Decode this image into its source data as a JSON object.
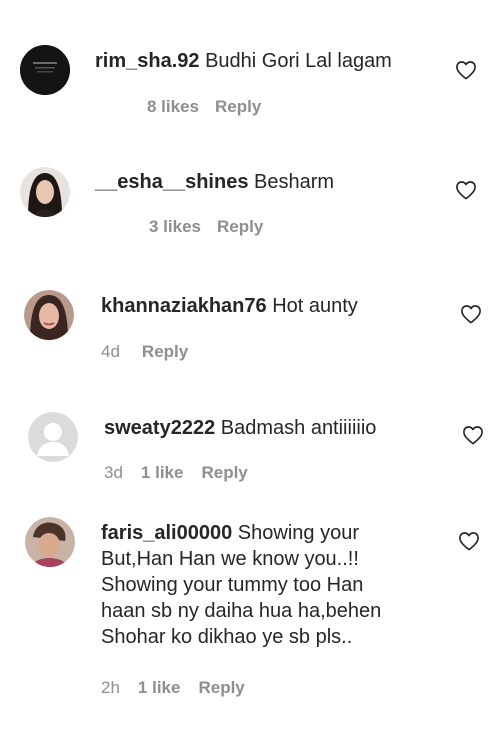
{
  "comments": [
    {
      "username": "rim_sha.92",
      "text": "Budhi Gori Lal lagam",
      "time": "",
      "likes": "8 likes",
      "reply": "Reply"
    },
    {
      "username": "__esha__shines",
      "text": "Besharm",
      "time": "",
      "likes": "3 likes",
      "reply": "Reply"
    },
    {
      "username": "khannaziakhan76",
      "text": "Hot aunty",
      "time": "4d",
      "likes": "",
      "reply": "Reply"
    },
    {
      "username": "sweaty2222",
      "text": "Badmash antiiiiiio",
      "time": "3d",
      "likes": "1 like",
      "reply": "Reply"
    },
    {
      "username": "faris_ali00000",
      "text": "Showing your But,Han Han we know you..!! Showing your tummy too Han haan sb ny daiha hua ha,behen Shohar ko dikhao ye sb pls..",
      "time": "2h",
      "likes": "1 like",
      "reply": "Reply"
    }
  ],
  "icons": {
    "like": "heart-outline-icon",
    "default_avatar": "default-avatar-icon"
  },
  "colors": {
    "text": "#262626",
    "secondary": "#8e8e8e",
    "background": "#ffffff"
  }
}
